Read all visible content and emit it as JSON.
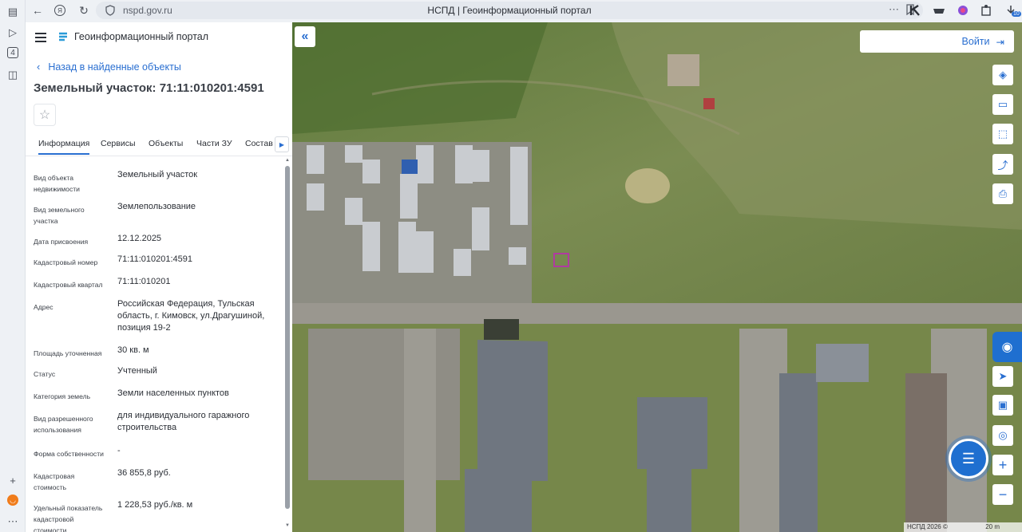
{
  "browser": {
    "url": "nspd.gov.ru",
    "page_title": "НСПД | Геоинформационный портал",
    "rail_badge": "4",
    "extension_badge": "10"
  },
  "panel": {
    "portal_name": "Геоинформационный портал",
    "back_link": "Назад в найденные объекты",
    "title": "Земельный участок: 71:11:010201:4591",
    "tabs": [
      {
        "label": "Информация",
        "active": true
      },
      {
        "label": "Сервисы",
        "active": false
      },
      {
        "label": "Объекты",
        "active": false
      },
      {
        "label": "Части ЗУ",
        "active": false
      },
      {
        "label": "Состав",
        "active": false
      }
    ],
    "fields": [
      {
        "label": "Вид объекта недвижимости",
        "value": "Земельный участок"
      },
      {
        "label": "Вид земельного участка",
        "value": "Землепользование"
      },
      {
        "label": "Дата присвоения",
        "value": "12.12.2025"
      },
      {
        "label": "Кадастровый номер",
        "value": "71:11:010201:4591"
      },
      {
        "label": "Кадастровый квартал",
        "value": "71:11:010201"
      },
      {
        "label": "Адрес",
        "value": "Российская Федерация, Тульская область, г. Кимовск, ул.Драгушиной, позиция 19-2"
      },
      {
        "label": "Площадь уточненная",
        "value": "30 кв. м"
      },
      {
        "label": "Статус",
        "value": "Учтенный"
      },
      {
        "label": "Категория земель",
        "value": "Земли населенных пунктов"
      },
      {
        "label": "Вид разрешенного использования",
        "value": "для индивидуального гаражного строительства"
      },
      {
        "label": "Форма собственности",
        "value": "-"
      },
      {
        "label": "Кадастровая стоимость",
        "value": "36 855,8 руб."
      },
      {
        "label": "Удельный показатель кадастровой стоимости",
        "value": "1 228,53 руб./кв. м"
      }
    ]
  },
  "map": {
    "login_label": "Войти",
    "copyright": "НСПД 2026 ©",
    "scale_label": "20 m",
    "accent_color": "#2a6fd1",
    "tools": [
      "layers-icon",
      "ruler-icon",
      "select-area-icon",
      "share-icon",
      "print-icon",
      "locate-icon",
      "mini-map-icon",
      "location-search-icon",
      "zoom-in-icon",
      "zoom-out-icon"
    ]
  }
}
